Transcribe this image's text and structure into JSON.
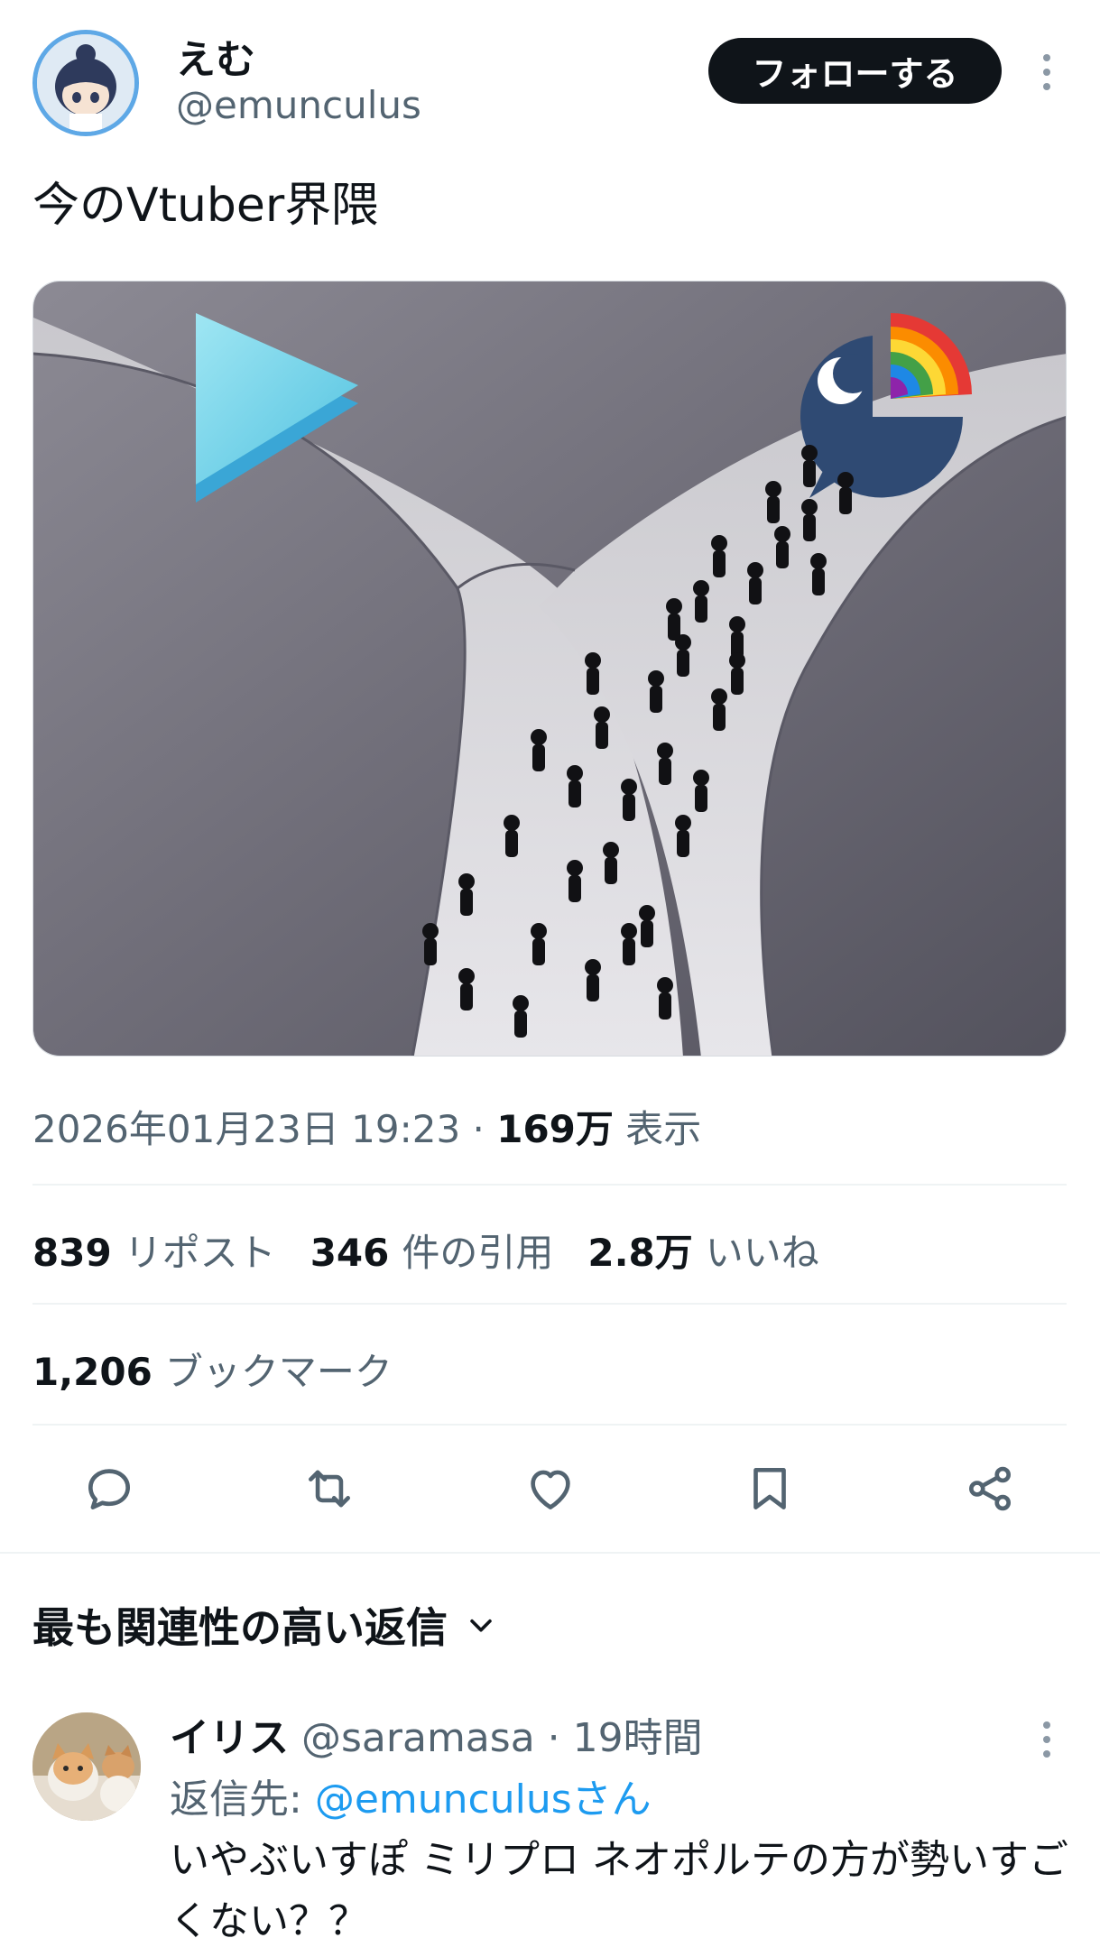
{
  "author": {
    "display_name": "えむ",
    "handle": "@emunculus",
    "follow_label": "フォローする"
  },
  "tweet": {
    "text": "今のVtuber界隈",
    "timestamp": "2026年01月23日 19:23",
    "separator": " · ",
    "views_count": "169万",
    "views_label": " 表示"
  },
  "stats": {
    "reposts_count": "839",
    "reposts_label": "リポスト",
    "quotes_count": "346",
    "quotes_label": "件の引用",
    "likes_count": "2.8万",
    "likes_label": "いいね",
    "bookmarks_count": "1,206",
    "bookmarks_label": "ブックマーク"
  },
  "actions": {
    "icons": [
      "reply-icon",
      "repost-icon",
      "like-icon",
      "bookmark-icon",
      "share-icon"
    ]
  },
  "replies_section": {
    "title": "最も関連性の高い返信"
  },
  "reply": {
    "display_name": "イリス",
    "handle": "@saramasa",
    "separator": " · ",
    "time": "19時間",
    "reply_to_label": "返信先: ",
    "reply_to_handle": "@emunculusさん",
    "text": "いやぶいすぽ ミリプロ ネオポルテの方が勢いすごくない？？"
  },
  "colors": {
    "text_primary": "#0f1419",
    "text_secondary": "#536471",
    "link": "#1d9bf0",
    "follow_bg": "#0f1419",
    "divider": "#eff3f4"
  }
}
